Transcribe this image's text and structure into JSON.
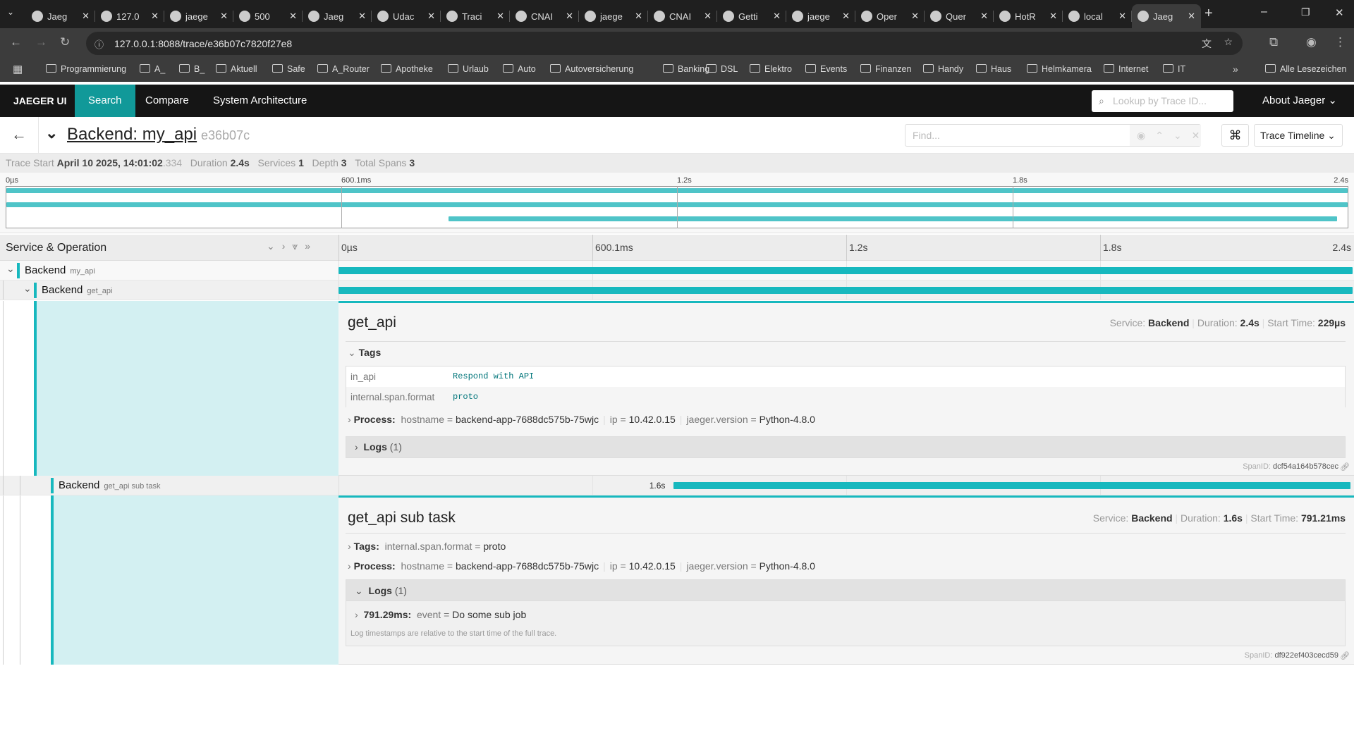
{
  "browser": {
    "tabs": [
      "Jaeg",
      "127.0",
      "jaege",
      "500",
      "Jaeg",
      "Udac",
      "Traci",
      "CNAI",
      "jaege",
      "CNAI",
      "Getti",
      "jaege",
      "Oper",
      "Quer",
      "HotR",
      "local",
      "Jaeg"
    ],
    "active_tab": 16,
    "url": "127.0.0.1:8088/trace/e36b07c7820f27e8",
    "bookmarks": [
      "Programmierung",
      "A_",
      "B_",
      "Aktuell",
      "Safe",
      "A_Router",
      "Apotheke",
      "Urlaub",
      "Auto",
      "Autoversicherung",
      "Banking",
      "DSL",
      "Elektro",
      "Events",
      "Finanzen",
      "Handy",
      "Haus",
      "Helmkamera",
      "Internet",
      "IT"
    ],
    "all_bookmarks": "Alle Lesezeichen"
  },
  "nav": {
    "brand": "JAEGER UI",
    "items": [
      "Search",
      "Compare",
      "System Architecture"
    ],
    "active": "Search",
    "lookup_placeholder": "Lookup by Trace ID...",
    "about": "About Jaeger"
  },
  "trace": {
    "title": "Backend: my_api",
    "trace_id_short": "e36b07c",
    "find_placeholder": "Find...",
    "view_label": "Trace Timeline",
    "stats": {
      "start_label": "Trace Start",
      "start": "April 10 2025, 14:01:02",
      "start_ms": ".334",
      "duration_label": "Duration",
      "duration": "2.4s",
      "services_label": "Services",
      "services": "1",
      "depth_label": "Depth",
      "depth": "3",
      "spans_label": "Total Spans",
      "spans": "3"
    },
    "ticks": [
      "0µs",
      "600.1ms",
      "1.2s",
      "1.8s",
      "2.4s"
    ],
    "column_header": "Service & Operation"
  },
  "accent": "#17b8be",
  "spans": [
    {
      "service": "Backend",
      "operation": "my_api",
      "start_ms": 0,
      "duration_ms": 2400
    },
    {
      "service": "Backend",
      "operation": "get_api",
      "start_ms": 0.229,
      "duration_ms": 2400,
      "detail": {
        "title": "get_api",
        "service": "Backend",
        "duration": "2.4s",
        "start": "229µs",
        "tags_label": "Tags",
        "tags": [
          {
            "k": "in_api",
            "v": "Respond with API"
          },
          {
            "k": "internal.span.format",
            "v": "proto"
          }
        ],
        "process": [
          {
            "k": "hostname",
            "v": "backend-app-7688dc575b-75wjc"
          },
          {
            "k": "ip",
            "v": "10.42.0.15"
          },
          {
            "k": "jaeger.version",
            "v": "Python-4.8.0"
          }
        ],
        "logs_label": "Logs",
        "logs_count": "(1)",
        "span_id": "dcf54a164b578cec"
      }
    },
    {
      "service": "Backend",
      "operation": "get_api sub task",
      "start_ms": 791.21,
      "duration_ms": 1600,
      "bar_label": "1.6s",
      "detail": {
        "title": "get_api sub task",
        "service": "Backend",
        "duration": "1.6s",
        "start": "791.21ms",
        "tags_inline": "internal.span.format",
        "tags_inline_v": "proto",
        "process": [
          {
            "k": "hostname",
            "v": "backend-app-7688dc575b-75wjc"
          },
          {
            "k": "ip",
            "v": "10.42.0.15"
          },
          {
            "k": "jaeger.version",
            "v": "Python-4.8.0"
          }
        ],
        "logs_label": "Logs",
        "logs_count": "(1)",
        "log": {
          "time": "791.29ms:",
          "k": "event",
          "v": "Do some sub job"
        },
        "log_note": "Log timestamps are relative to the start time of the full trace.",
        "span_id": "df922ef403cecd59"
      }
    }
  ],
  "labels": {
    "service": "Service:",
    "duration": "Duration:",
    "start": "Start Time:",
    "process": "Process:",
    "tags": "Tags:",
    "spanid": "SpanID:"
  }
}
